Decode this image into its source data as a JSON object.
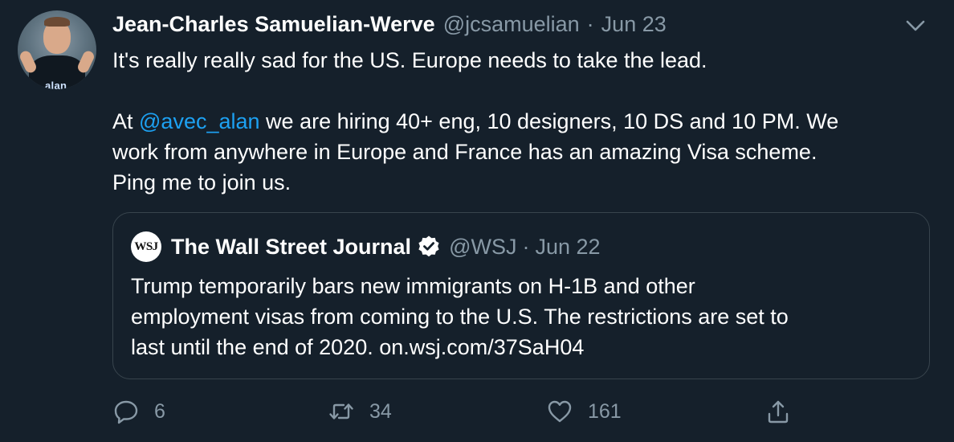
{
  "tweet": {
    "author": {
      "display_name": "Jean-Charles Samuelian-Werve",
      "handle": "@jcsamuelian",
      "avatar_logo_text": "alan"
    },
    "separator": "·",
    "date": "Jun 23",
    "text_lines": [
      "It's really really sad for the US. Europe needs to take the lead.",
      "",
      "we are hiring 40+ eng, 10 designers, 10 DS and 10 PM. We",
      "work from anywhere in Europe and France has an amazing Visa scheme.",
      "Ping me to join us."
    ],
    "line3_prefix": "At ",
    "mention": "@avec_alan",
    "quoted": {
      "avatar_text": "WSJ",
      "display_name": "The Wall Street Journal",
      "verified": true,
      "handle": "@WSJ",
      "separator": "·",
      "date": "Jun 22",
      "text_lines": [
        "Trump temporarily bars new immigrants on H-1B and other",
        "employment visas from coming to the U.S. The restrictions are set to",
        "last until the end of 2020. on.wsj.com/37SaH04"
      ]
    },
    "actions": {
      "reply": {
        "icon": "reply-icon",
        "count": "6"
      },
      "retweet": {
        "icon": "retweet-icon",
        "count": "34"
      },
      "like": {
        "icon": "heart-icon",
        "count": "161"
      },
      "share": {
        "icon": "share-icon"
      }
    },
    "colors": {
      "background": "#15202b",
      "text": "#ffffff",
      "secondary": "#8899a6",
      "link": "#1da1f2",
      "border": "#38444d"
    }
  }
}
